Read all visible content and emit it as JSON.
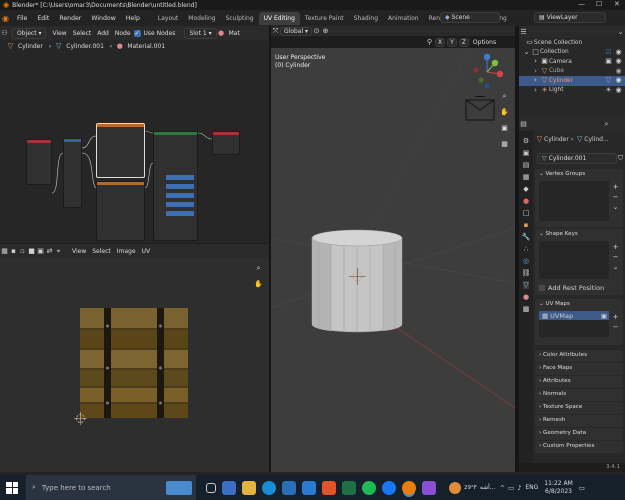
{
  "window": {
    "title": "Blender* [C:\\Users\\omar3\\Documents\\Blender\\untitled.blend]",
    "minimize": "—",
    "maximize": "☐",
    "close": "✕"
  },
  "menus": [
    "File",
    "Edit",
    "Render",
    "Window",
    "Help"
  ],
  "workspaces": [
    "Layout",
    "Modeling",
    "Sculpting",
    "UV Editing",
    "Texture Paint",
    "Shading",
    "Animation",
    "Rendering",
    "Compositing"
  ],
  "active_workspace": "UV Editing",
  "scene": "Scene",
  "view_layer": "ViewLayer",
  "shader_header": {
    "mode": "Object",
    "items": [
      "View",
      "Select",
      "Add",
      "Node"
    ],
    "use_nodes": "Use Nodes",
    "slot": "Slot 1",
    "mat": "Mat"
  },
  "breadcrumb": [
    "Cylinder",
    "Cylinder.001",
    "Material.001"
  ],
  "view3d_header": {
    "orientation": "Global",
    "axes": [
      "X",
      "Y",
      "Z"
    ],
    "options": "Options"
  },
  "viewport": {
    "title": "User Perspective",
    "subtitle": "(0) Cylinder"
  },
  "uv_header": {
    "items": [
      "View",
      "Select",
      "Image",
      "UV"
    ]
  },
  "outliner": {
    "collection_root": "Scene Collection",
    "items": [
      {
        "name": "Collection",
        "color": "#dddddd",
        "icon": "□"
      },
      {
        "name": "Camera",
        "color": "#dddddd",
        "icon": "▣"
      },
      {
        "name": "Cube",
        "color": "#aaaaaa",
        "icon": "▽"
      },
      {
        "name": "Cylinder",
        "color": "#e8a060",
        "icon": "▽"
      },
      {
        "name": "Light",
        "color": "#dddddd",
        "icon": "☀"
      }
    ]
  },
  "properties": {
    "breadcrumb": [
      "Cylinder",
      "Cylind..."
    ],
    "mesh_name": "Cylinder.001",
    "panels": {
      "vertex_groups": "Vertex Groups",
      "shape_keys": "Shape Keys",
      "add_rest_position": "Add Rest Position",
      "uv_maps": "UV Maps",
      "uv_map_item": "UVMap",
      "collapsed": [
        "Color Attributes",
        "Face Maps",
        "Attributes",
        "Normals",
        "Texture Space",
        "Remesh",
        "Geometry Data",
        "Custom Properties"
      ]
    }
  },
  "version": "3.4.1",
  "taskbar": {
    "search_placeholder": "Type here to search",
    "weather": "29°F",
    "weather_text": "أشه...",
    "language": "ENG",
    "time": "11:22 AM",
    "date": "6/8/2023"
  },
  "colors": {
    "accent": "#3e6fb2",
    "orange": "#e08a3a",
    "wood": "#6b5524"
  }
}
